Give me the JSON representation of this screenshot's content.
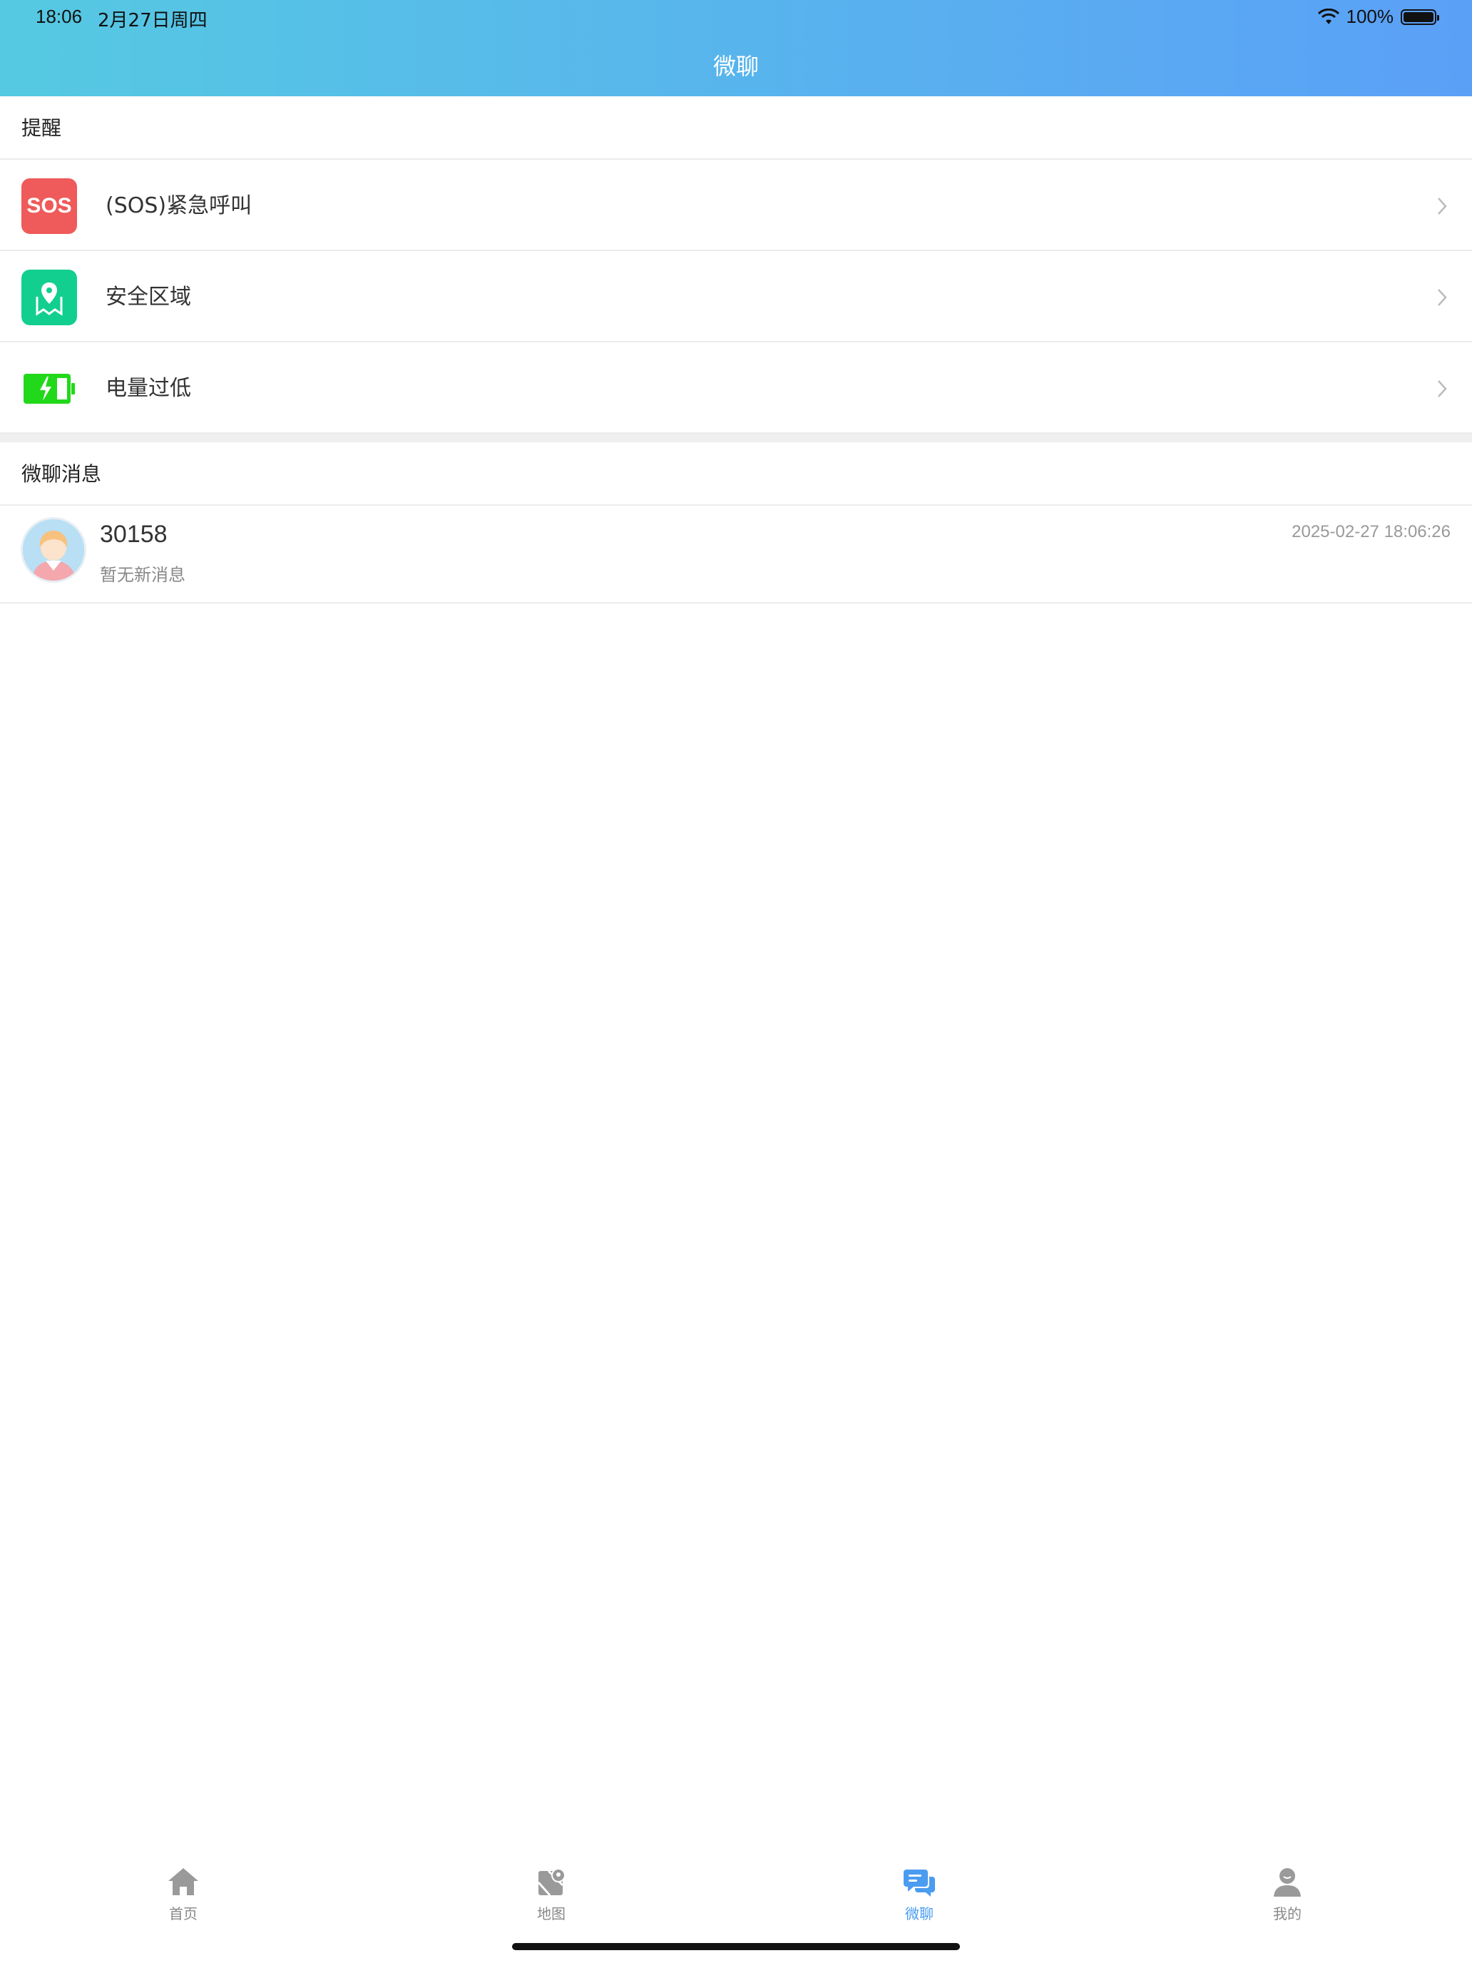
{
  "status_bar": {
    "time": "18:06",
    "date": "2月27日周四",
    "battery": "100%"
  },
  "header": {
    "title": "微聊"
  },
  "reminders": {
    "section_title": "提醒",
    "items": [
      {
        "label": "(SOS)紧急呼叫",
        "icon": "sos-icon",
        "icon_text": "SOS",
        "color": "#ef5a5a"
      },
      {
        "label": "安全区域",
        "icon": "map-pin-icon",
        "color": "#12cf8f"
      },
      {
        "label": "电量过低",
        "icon": "low-battery-icon",
        "color": "#22d81a"
      }
    ]
  },
  "chats": {
    "section_title": "微聊消息",
    "items": [
      {
        "name": "30158",
        "preview": "暂无新消息",
        "time": "2025-02-27 18:06:26"
      }
    ]
  },
  "tabbar": {
    "active": "微聊",
    "accent": "#4a9cf0",
    "items": [
      {
        "label": "首页",
        "icon": "home-icon"
      },
      {
        "label": "地图",
        "icon": "map-icon"
      },
      {
        "label": "微聊",
        "icon": "chat-icon"
      },
      {
        "label": "我的",
        "icon": "profile-icon"
      }
    ]
  }
}
